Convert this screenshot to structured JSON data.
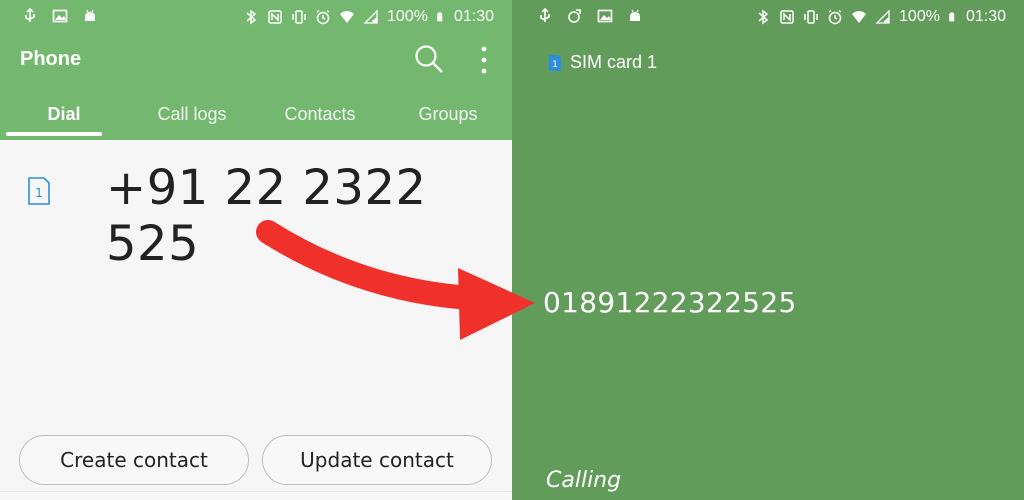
{
  "left": {
    "status": {
      "battery": "100%",
      "time": "01:30"
    },
    "app_title": "Phone",
    "tabs": [
      {
        "label": "Dial",
        "active": true
      },
      {
        "label": "Call logs"
      },
      {
        "label": "Contacts"
      },
      {
        "label": "Groups"
      }
    ],
    "sim_number": "1",
    "dialed_number": "+91 22 2322 525",
    "buttons": {
      "create": "Create contact",
      "update": "Update contact"
    }
  },
  "right": {
    "status": {
      "battery": "100%",
      "time": "01:30"
    },
    "sim_label": "SIM card 1",
    "sim_number": "1",
    "call_number": "01891222322525",
    "calling_text": "Calling"
  },
  "colors": {
    "header_green": "#74b76f",
    "call_green": "#629c5a",
    "arrow_red": "#f0302a",
    "sim_blue": "#2d8ee0"
  }
}
